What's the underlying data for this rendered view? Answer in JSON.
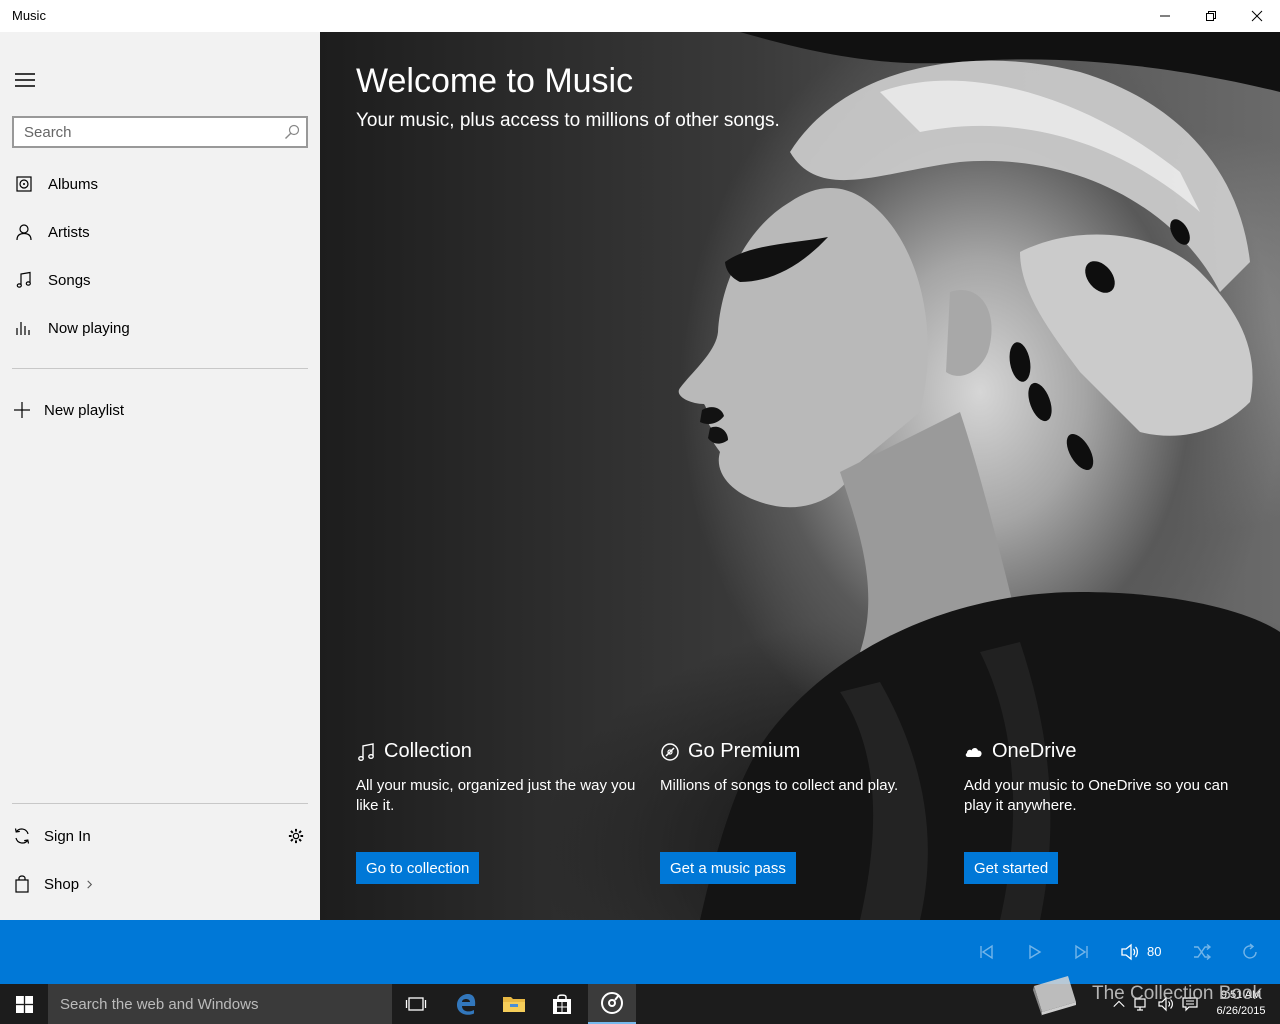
{
  "window": {
    "title": "Music",
    "controls": {
      "minimize": "minimize",
      "restore": "restore",
      "close": "close"
    }
  },
  "sidebar": {
    "search_placeholder": "Search",
    "nav": [
      {
        "label": "Albums",
        "icon": "album-icon"
      },
      {
        "label": "Artists",
        "icon": "person-icon"
      },
      {
        "label": "Songs",
        "icon": "music-note-icon"
      },
      {
        "label": "Now playing",
        "icon": "equalizer-icon"
      }
    ],
    "new_playlist": "New playlist",
    "sign_in": "Sign In",
    "shop": "Shop"
  },
  "hero": {
    "title": "Welcome to Music",
    "subtitle": "Your music, plus access to millions of other songs.",
    "features": [
      {
        "title": "Collection",
        "icon": "music-note-icon",
        "desc": "All your music, organized just the way you like it.",
        "button": "Go to collection"
      },
      {
        "title": "Go Premium",
        "icon": "premium-icon",
        "desc": "Millions of songs to collect and play.",
        "button": "Get a music pass"
      },
      {
        "title": "OneDrive",
        "icon": "cloud-icon",
        "desc": "Add your music to OneDrive so you can play it anywhere.",
        "button": "Get started"
      }
    ]
  },
  "player": {
    "volume": "80"
  },
  "taskbar": {
    "search_text": "Search the web and Windows",
    "time": "9:51 AM",
    "date": "6/26/2015"
  },
  "watermark": {
    "text": "The Collection Book"
  },
  "colors": {
    "accent": "#0078d7",
    "sidebar_bg": "#f2f2f2",
    "taskbar_bg": "#1c1c1c"
  }
}
